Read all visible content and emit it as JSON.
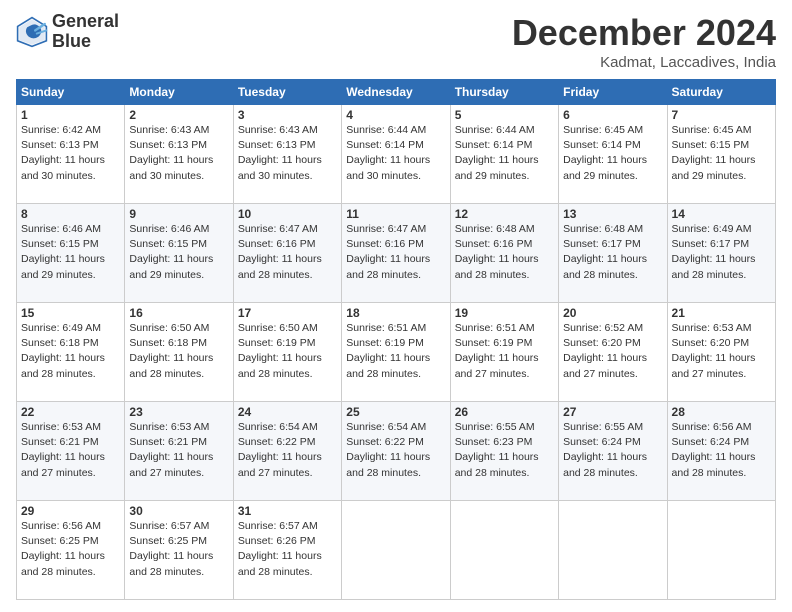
{
  "logo": {
    "line1": "General",
    "line2": "Blue"
  },
  "title": "December 2024",
  "location": "Kadmat, Laccadives, India",
  "days_of_week": [
    "Sunday",
    "Monday",
    "Tuesday",
    "Wednesday",
    "Thursday",
    "Friday",
    "Saturday"
  ],
  "weeks": [
    [
      {
        "day": "1",
        "sunrise": "6:42 AM",
        "sunset": "6:13 PM",
        "daylight": "11 hours and 30 minutes."
      },
      {
        "day": "2",
        "sunrise": "6:43 AM",
        "sunset": "6:13 PM",
        "daylight": "11 hours and 30 minutes."
      },
      {
        "day": "3",
        "sunrise": "6:43 AM",
        "sunset": "6:13 PM",
        "daylight": "11 hours and 30 minutes."
      },
      {
        "day": "4",
        "sunrise": "6:44 AM",
        "sunset": "6:14 PM",
        "daylight": "11 hours and 30 minutes."
      },
      {
        "day": "5",
        "sunrise": "6:44 AM",
        "sunset": "6:14 PM",
        "daylight": "11 hours and 29 minutes."
      },
      {
        "day": "6",
        "sunrise": "6:45 AM",
        "sunset": "6:14 PM",
        "daylight": "11 hours and 29 minutes."
      },
      {
        "day": "7",
        "sunrise": "6:45 AM",
        "sunset": "6:15 PM",
        "daylight": "11 hours and 29 minutes."
      }
    ],
    [
      {
        "day": "8",
        "sunrise": "6:46 AM",
        "sunset": "6:15 PM",
        "daylight": "11 hours and 29 minutes."
      },
      {
        "day": "9",
        "sunrise": "6:46 AM",
        "sunset": "6:15 PM",
        "daylight": "11 hours and 29 minutes."
      },
      {
        "day": "10",
        "sunrise": "6:47 AM",
        "sunset": "6:16 PM",
        "daylight": "11 hours and 28 minutes."
      },
      {
        "day": "11",
        "sunrise": "6:47 AM",
        "sunset": "6:16 PM",
        "daylight": "11 hours and 28 minutes."
      },
      {
        "day": "12",
        "sunrise": "6:48 AM",
        "sunset": "6:16 PM",
        "daylight": "11 hours and 28 minutes."
      },
      {
        "day": "13",
        "sunrise": "6:48 AM",
        "sunset": "6:17 PM",
        "daylight": "11 hours and 28 minutes."
      },
      {
        "day": "14",
        "sunrise": "6:49 AM",
        "sunset": "6:17 PM",
        "daylight": "11 hours and 28 minutes."
      }
    ],
    [
      {
        "day": "15",
        "sunrise": "6:49 AM",
        "sunset": "6:18 PM",
        "daylight": "11 hours and 28 minutes."
      },
      {
        "day": "16",
        "sunrise": "6:50 AM",
        "sunset": "6:18 PM",
        "daylight": "11 hours and 28 minutes."
      },
      {
        "day": "17",
        "sunrise": "6:50 AM",
        "sunset": "6:19 PM",
        "daylight": "11 hours and 28 minutes."
      },
      {
        "day": "18",
        "sunrise": "6:51 AM",
        "sunset": "6:19 PM",
        "daylight": "11 hours and 28 minutes."
      },
      {
        "day": "19",
        "sunrise": "6:51 AM",
        "sunset": "6:19 PM",
        "daylight": "11 hours and 27 minutes."
      },
      {
        "day": "20",
        "sunrise": "6:52 AM",
        "sunset": "6:20 PM",
        "daylight": "11 hours and 27 minutes."
      },
      {
        "day": "21",
        "sunrise": "6:53 AM",
        "sunset": "6:20 PM",
        "daylight": "11 hours and 27 minutes."
      }
    ],
    [
      {
        "day": "22",
        "sunrise": "6:53 AM",
        "sunset": "6:21 PM",
        "daylight": "11 hours and 27 minutes."
      },
      {
        "day": "23",
        "sunrise": "6:53 AM",
        "sunset": "6:21 PM",
        "daylight": "11 hours and 27 minutes."
      },
      {
        "day": "24",
        "sunrise": "6:54 AM",
        "sunset": "6:22 PM",
        "daylight": "11 hours and 27 minutes."
      },
      {
        "day": "25",
        "sunrise": "6:54 AM",
        "sunset": "6:22 PM",
        "daylight": "11 hours and 28 minutes."
      },
      {
        "day": "26",
        "sunrise": "6:55 AM",
        "sunset": "6:23 PM",
        "daylight": "11 hours and 28 minutes."
      },
      {
        "day": "27",
        "sunrise": "6:55 AM",
        "sunset": "6:24 PM",
        "daylight": "11 hours and 28 minutes."
      },
      {
        "day": "28",
        "sunrise": "6:56 AM",
        "sunset": "6:24 PM",
        "daylight": "11 hours and 28 minutes."
      }
    ],
    [
      {
        "day": "29",
        "sunrise": "6:56 AM",
        "sunset": "6:25 PM",
        "daylight": "11 hours and 28 minutes."
      },
      {
        "day": "30",
        "sunrise": "6:57 AM",
        "sunset": "6:25 PM",
        "daylight": "11 hours and 28 minutes."
      },
      {
        "day": "31",
        "sunrise": "6:57 AM",
        "sunset": "6:26 PM",
        "daylight": "11 hours and 28 minutes."
      },
      null,
      null,
      null,
      null
    ]
  ]
}
